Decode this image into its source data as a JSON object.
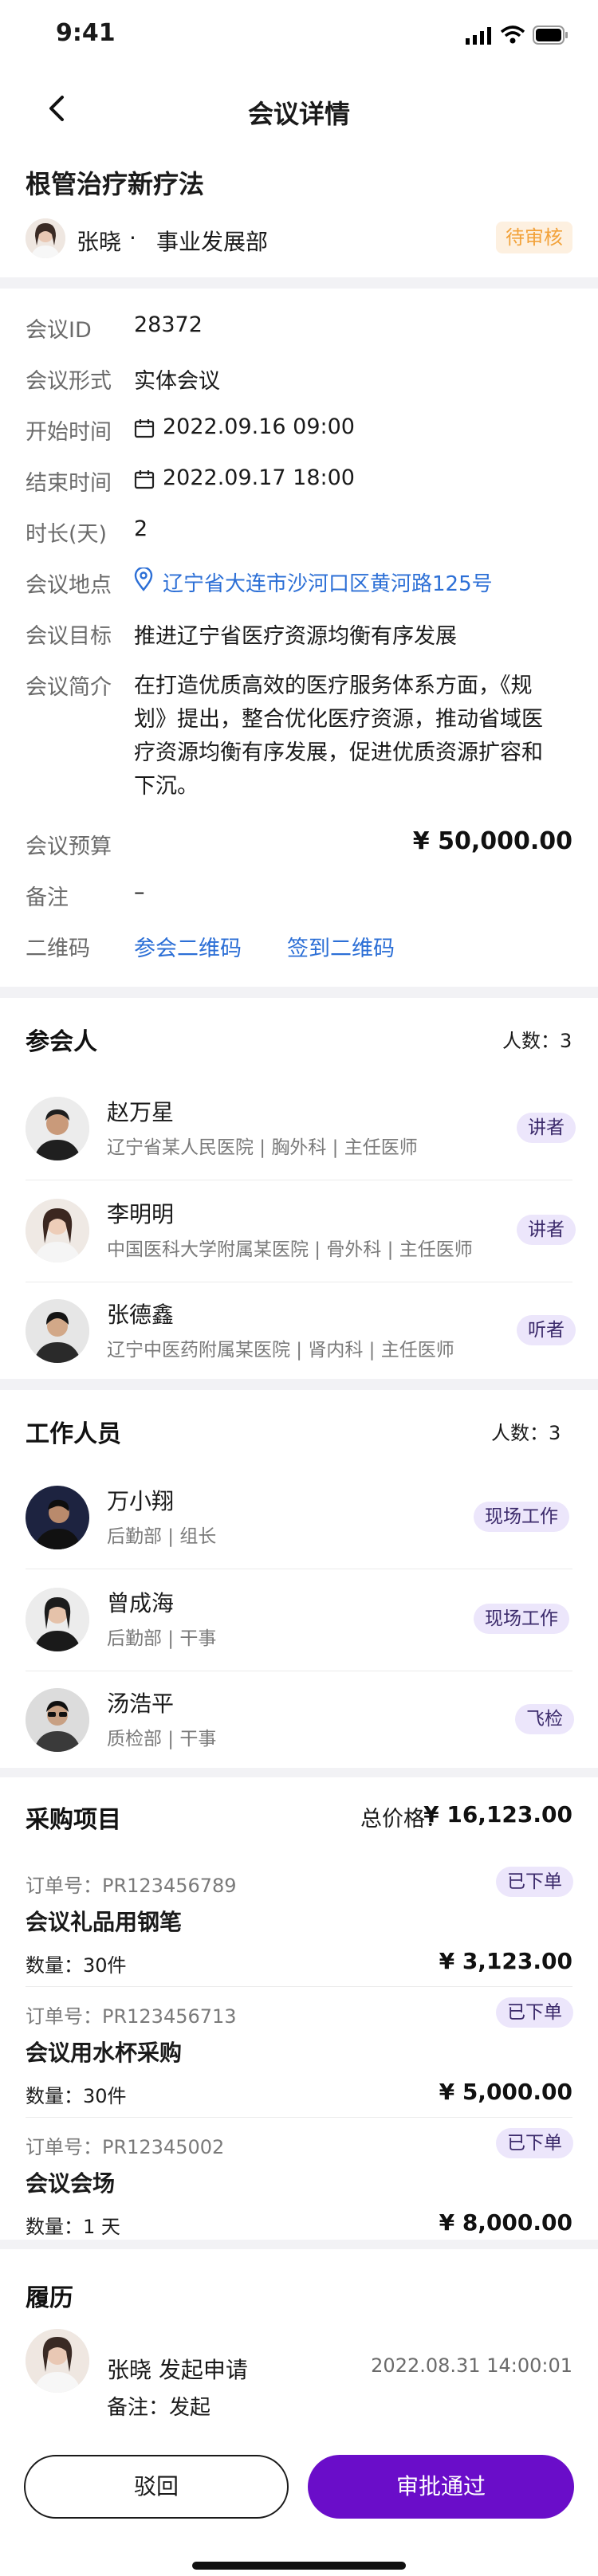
{
  "status_bar": {
    "time": "9:41"
  },
  "nav": {
    "title": "会议详情"
  },
  "header": {
    "meeting_name": "根管治疗新疗法",
    "applicant": "张晓",
    "dot": "·",
    "department": "事业发展部",
    "status": "待审核"
  },
  "details": {
    "id_label": "会议ID",
    "id_value": "28372",
    "form_label": "会议形式",
    "form_value": "实体会议",
    "start_label": "开始时间",
    "start_value": "2022.09.16 09:00",
    "end_label": "结束时间",
    "end_value": "2022.09.17 18:00",
    "duration_label": "时长(天)",
    "duration_value": "2",
    "location_label": "会议地点",
    "location_value": "辽宁省大连市沙河口区黄河路125号",
    "goal_label": "会议目标",
    "goal_value": "推进辽宁省医疗资源均衡有序发展",
    "intro_label": "会议简介",
    "intro_lines": [
      "在打造优质高效的医疗服务体系方面，《规",
      "划》提出，整合优化医疗资源，推动省域医",
      "疗资源均衡有序发展，促进优质资源扩容和",
      "下沉。"
    ],
    "budget_label": "会议预算",
    "budget_value": "¥ 50,000.00",
    "note_label": "备注",
    "note_value": "–",
    "qr_label": "二维码",
    "qr_join": "参会二维码",
    "qr_signin": "签到二维码"
  },
  "participants": {
    "title": "参会人",
    "count": "人数：3",
    "items": [
      {
        "name": "赵万星",
        "info": "辽宁省某人民医院 | 胸外科 | 主任医师",
        "role": "讲者"
      },
      {
        "name": "李明明",
        "info": "中国医科大学附属某医院 | 骨外科 | 主任医师",
        "role": "讲者"
      },
      {
        "name": "张德鑫",
        "info": "辽宁中医药附属某医院 | 肾内科 | 主任医师",
        "role": "听者"
      }
    ]
  },
  "staff": {
    "title": "工作人员",
    "count": "人数：3",
    "items": [
      {
        "name": "万小翔",
        "info": "后勤部 | 组长",
        "role": "现场工作"
      },
      {
        "name": "曾成海",
        "info": "后勤部 | 干事",
        "role": "现场工作"
      },
      {
        "name": "汤浩平",
        "info": "质检部 | 干事",
        "role": "飞检"
      }
    ]
  },
  "purchase": {
    "title": "采购项目",
    "total_label": "总价格：",
    "total_value": "¥ 16,123.00",
    "items": [
      {
        "order": "订单号：PR123456789",
        "status": "已下单",
        "name": "会议礼品用钢笔",
        "qty": "数量：30件",
        "price": "¥ 3,123.00"
      },
      {
        "order": "订单号：PR123456713",
        "status": "已下单",
        "name": "会议用水杯采购",
        "qty": "数量：30件",
        "price": "¥ 5,000.00"
      },
      {
        "order": "订单号：PR12345002",
        "status": "已下单",
        "name": "会议会场",
        "qty": "数量：1 天",
        "price": "¥ 8,000.00"
      }
    ]
  },
  "history": {
    "title": "履历",
    "entry": {
      "actor": "张晓 发起申请",
      "time": "2022.08.31 14:00:01",
      "note": "备注：发起"
    }
  },
  "actions": {
    "reject": "驳回",
    "approve": "审批通过"
  },
  "colors": {
    "accent": "#6a0dc9",
    "link": "#2c6fd6",
    "pending": "#f2a23a"
  }
}
